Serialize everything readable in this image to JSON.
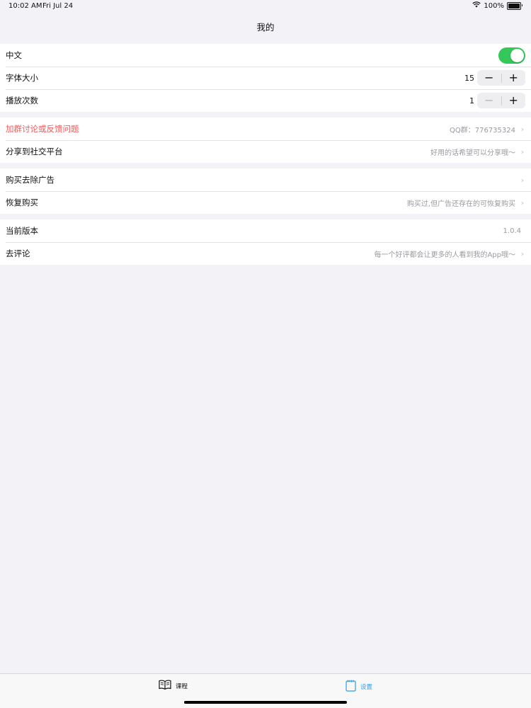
{
  "status_bar": {
    "time": "10:02 AM",
    "date": "Fri Jul 24",
    "battery": "100%",
    "battery_level": 1.0
  },
  "nav": {
    "title": "我的"
  },
  "settings": {
    "language": {
      "label": "中文",
      "enabled": true
    },
    "font_size": {
      "label": "字体大小",
      "value": "15",
      "minus": "−",
      "plus": "+"
    },
    "play_count": {
      "label": "播放次数",
      "value": "1",
      "minus": "−",
      "plus": "+"
    }
  },
  "community": {
    "join_group": {
      "label": "加群讨论或反馈问题",
      "detail": "QQ群：776735324"
    },
    "share": {
      "label": "分享到社交平台",
      "detail": "好用的话希望可以分享哦～"
    }
  },
  "purchase": {
    "remove_ads": {
      "label": "购买去除广告",
      "detail": ""
    },
    "restore": {
      "label": "恢复购买",
      "detail": "购买过,但广告还存在的可恢复购买"
    }
  },
  "about": {
    "version": {
      "label": "当前版本",
      "detail": "1.0.4"
    },
    "review": {
      "label": "去评论",
      "detail": "每一个好评都会让更多的人看到我的App哦～"
    }
  },
  "tabs": [
    {
      "label": "课程",
      "icon": "book-icon",
      "selected": false
    },
    {
      "label": "设置",
      "icon": "notepad-icon",
      "selected": true
    }
  ],
  "colors": {
    "accent": "#2f9be8",
    "toggle_on": "#34c759",
    "destructive_label": "#f05a5a",
    "background": "#f2f2f7"
  }
}
